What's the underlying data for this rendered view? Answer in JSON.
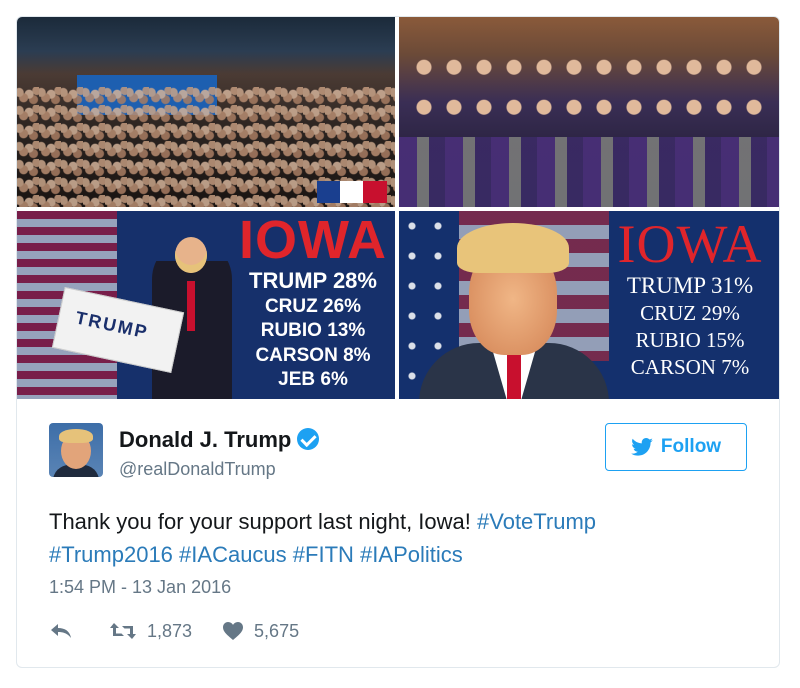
{
  "media": {
    "poll_left": {
      "state": "IOWA",
      "lines": [
        "TRUMP 28%",
        "CRUZ 26%",
        "RUBIO 13%",
        "CARSON 8%",
        "JEB 6%"
      ],
      "sign_text": "TRUMP"
    },
    "poll_right": {
      "state": "IOWA",
      "lines": [
        "TRUMP 31%",
        "CRUZ 29%",
        "RUBIO 15%",
        "CARSON 7%"
      ]
    }
  },
  "tweet": {
    "name": "Donald J. Trump",
    "handle": "@realDonaldTrump",
    "follow_label": "Follow",
    "text_plain": "Thank you for your support last night, Iowa! ",
    "hashtags": [
      "#VoteTrump",
      "#Trump2016",
      "#IACaucus",
      "#FITN",
      "#IAPolitics"
    ],
    "timestamp": "1:54 PM - 13 Jan 2016",
    "retweets": "1,873",
    "likes": "5,675"
  },
  "colors": {
    "accent": "#1da1f2",
    "hashtag": "#2b7bb9",
    "muted": "#657786",
    "poll_red": "#e0252b",
    "poll_blue": "#16306b"
  }
}
